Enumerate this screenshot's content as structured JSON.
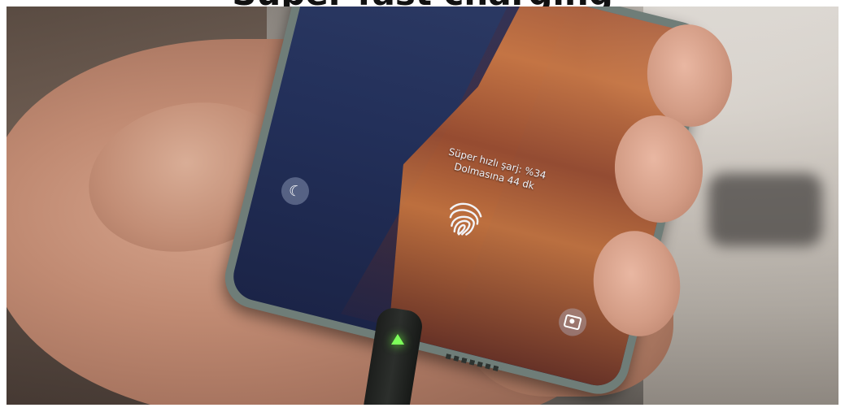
{
  "caption": {
    "text": "Super fast charging"
  },
  "lockscreen": {
    "line1": "Süper hızlı şarj: %34",
    "line2": "Dolmasına 44 dk"
  },
  "icons": {
    "fingerprint": "fingerprint-icon",
    "phone": "phone-icon",
    "camera": "camera-icon",
    "charging_led": "charging-led-icon"
  },
  "colors": {
    "led": "#7dff5a",
    "screen": "#23305a",
    "mountain": "#c8753e"
  }
}
